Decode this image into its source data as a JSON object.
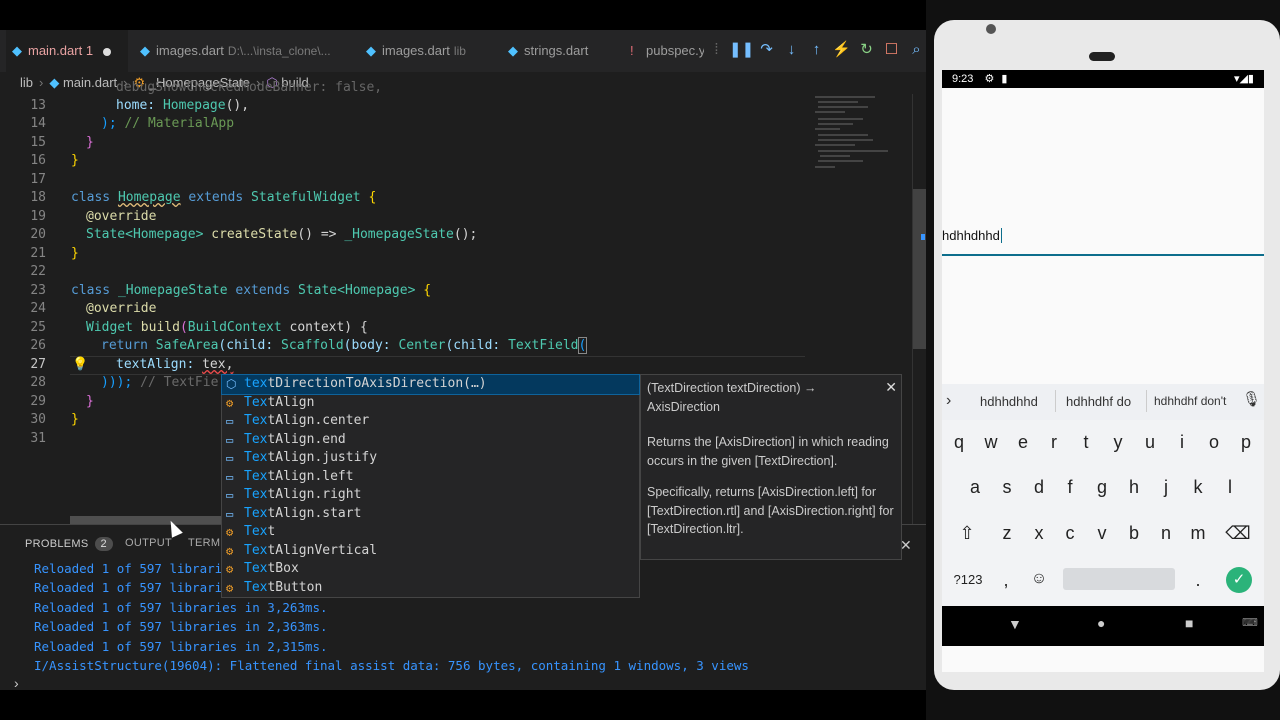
{
  "tabs": [
    {
      "label": "main.dart",
      "extra": "1",
      "active": true
    },
    {
      "label": "images.dart",
      "path": "D:\\...\\insta_clone\\..."
    },
    {
      "label": "images.dart",
      "path": "lib"
    },
    {
      "label": "strings.dart"
    },
    {
      "label": "pubspec.y"
    }
  ],
  "breadcrumb": [
    "lib",
    "main.dart",
    "_HomepageState",
    "build"
  ],
  "lines": [
    13,
    14,
    15,
    16,
    17,
    18,
    19,
    20,
    21,
    22,
    23,
    24,
    25,
    26,
    27,
    28,
    29,
    30,
    31
  ],
  "current_line": 27,
  "code": {
    "l12_partial": "debugShowCheckedModeBanner: false,",
    "l13_a": "home: ",
    "l13_b": "Homepage",
    "l13_c": "(),",
    "l14_a": "); ",
    "l14_b": "// MaterialApp",
    "l15": "}",
    "l16": "}",
    "l18_a": "class ",
    "l18_b": "Homepage",
    "l18_c": " extends ",
    "l18_d": "StatefulWidget",
    "l18_e": " {",
    "l19": "@override",
    "l20_a": "State<",
    "l20_b": "Homepage",
    "l20_c": "> ",
    "l20_d": "createState",
    "l20_e": "() => ",
    "l20_f": "_HomepageState",
    "l20_g": "();",
    "l21": "}",
    "l23_a": "class ",
    "l23_b": "_HomepageState",
    "l23_c": " extends ",
    "l23_d": "State<Homepage>",
    "l23_e": " {",
    "l24": "@override",
    "l25_a": "Widget ",
    "l25_b": "build",
    "l25_c": "(",
    "l25_d": "BuildContext",
    "l25_e": " context) {",
    "l26_a": "return ",
    "l26_b": "SafeArea",
    "l26_c": "(child: ",
    "l26_d": "Scaffold",
    "l26_e": "(body: ",
    "l26_f": "Center",
    "l26_g": "(child: ",
    "l26_h": "TextField",
    "l26_i": "(",
    "l27_a": "textAlign: ",
    "l27_b": "tex,",
    "l28_a": ")));",
    "l28_b": " // TextFie",
    "l29": "}",
    "l30": "}"
  },
  "suggestions": [
    {
      "match": "tex",
      "rest": "tDirectionToAxisDirection(…)",
      "icon": "method-icon",
      "selected": true
    },
    {
      "match": "Tex",
      "rest": "tAlign",
      "icon": "class-icon"
    },
    {
      "match": "Tex",
      "rest": "tAlign.center",
      "icon": "enum-icon"
    },
    {
      "match": "Tex",
      "rest": "tAlign.end",
      "icon": "enum-icon"
    },
    {
      "match": "Tex",
      "rest": "tAlign.justify",
      "icon": "enum-icon"
    },
    {
      "match": "Tex",
      "rest": "tAlign.left",
      "icon": "enum-icon"
    },
    {
      "match": "Tex",
      "rest": "tAlign.right",
      "icon": "enum-icon"
    },
    {
      "match": "Tex",
      "rest": "tAlign.start",
      "icon": "enum-icon"
    },
    {
      "match": "Tex",
      "rest": "t",
      "icon": "class-icon"
    },
    {
      "match": "Tex",
      "rest": "tAlignVertical",
      "icon": "class-icon"
    },
    {
      "match": "Tex",
      "rest": "tBox",
      "icon": "class-icon"
    },
    {
      "match": "Tex",
      "rest": "tButton",
      "icon": "class-icon"
    }
  ],
  "detail": {
    "signature": "(TextDirection textDirection) → AxisDirection",
    "p1": "Returns the [AxisDirection] in which reading occurs in the given [TextDirection].",
    "p2": "Specifically, returns [AxisDirection.left] for [TextDirection.rtl] and [AxisDirection.right] for [TextDirection.ltr]."
  },
  "panel": {
    "tabs": [
      "PROBLEMS",
      "OUTPUT",
      "TERMI"
    ],
    "problem_count": "2",
    "output": [
      "Reloaded 1 of 597 librari",
      "Reloaded 1 of 597 librari",
      "Reloaded 1 of 597 libraries in 3,263ms.",
      "Reloaded 1 of 597 libraries in 2,363ms.",
      "Reloaded 1 of 597 libraries in 2,315ms.",
      "I/AssistStructure(19604): Flattened final assist data: 756 bytes, containing 1 windows, 3 views"
    ]
  },
  "phone": {
    "time": "9:23",
    "text_field_value": "hdhhdhhd",
    "suggestions": [
      "hdhhdhhd",
      "hdhhdhf do",
      "hdhhdhf don't"
    ],
    "row1": [
      "q",
      "w",
      "e",
      "r",
      "t",
      "y",
      "u",
      "i",
      "o",
      "p"
    ],
    "row1_hints": [
      "1",
      "2",
      "3",
      "4",
      "5",
      "6",
      "7",
      "8",
      "9",
      "0"
    ],
    "row2": [
      "a",
      "s",
      "d",
      "f",
      "g",
      "h",
      "j",
      "k",
      "l"
    ],
    "row3": [
      "z",
      "x",
      "c",
      "v",
      "b",
      "n",
      "m"
    ],
    "bottom": {
      "sym": "?123",
      "comma": ",",
      "period": "."
    }
  },
  "colors": {
    "accent": "#0d6e8c",
    "link": "#18a3ff",
    "status_blue": "#3794ff"
  }
}
